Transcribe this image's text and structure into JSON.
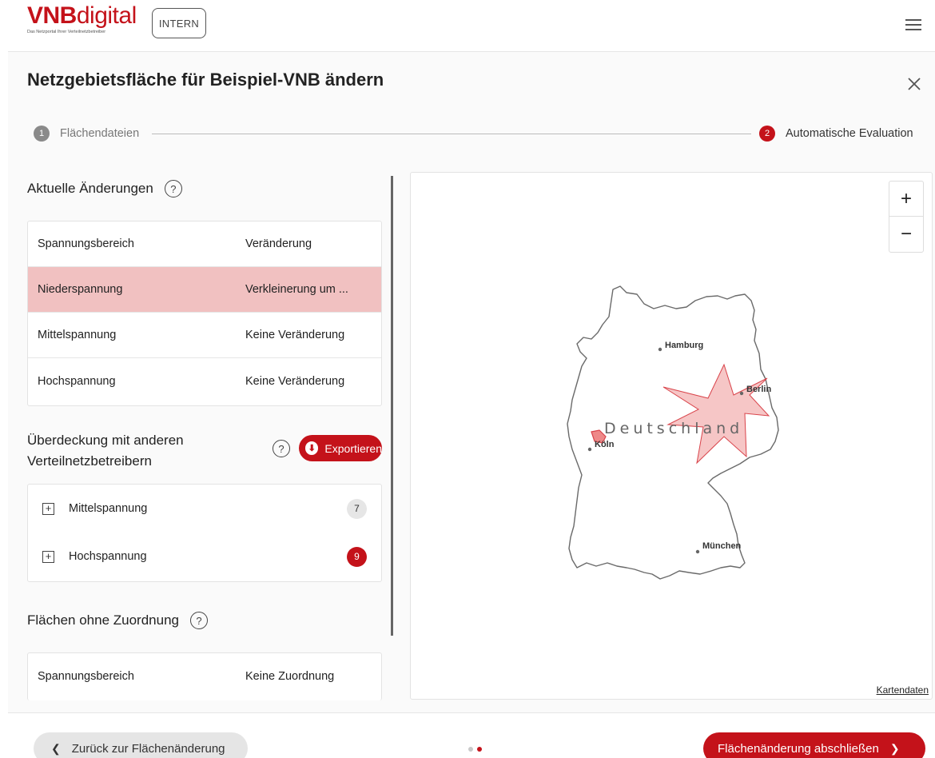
{
  "header": {
    "logo_bold": "VNB",
    "logo_light": "digital",
    "logo_tagline": "Das Netzportal Ihrer Verteilnetzbetreiber",
    "badge": "INTERN",
    "menu_icon": "hamburger-icon"
  },
  "dialog": {
    "title": "Netzgebietsfläche für Beispiel-VNB ändern",
    "close_icon": "close-icon",
    "steps": [
      {
        "num": "1",
        "label": "Flächendateien"
      },
      {
        "num": "2",
        "label": "Automatische Evaluation"
      }
    ]
  },
  "changes": {
    "title": "Aktuelle Änderungen",
    "help": "?",
    "header": {
      "c1": "Spannungsbereich",
      "c2": "Veränderung"
    },
    "rows": [
      {
        "c1": "Niederspannung",
        "c2": "Verkleinerung um ..."
      },
      {
        "c1": "Mittelspannung",
        "c2": "Keine Veränderung"
      },
      {
        "c1": "Hochspannung",
        "c2": "Keine Veränderung"
      }
    ]
  },
  "overlap": {
    "title_line1": "Überdeckung mit anderen",
    "title_line2": "Verteilnetzbetreibern",
    "help": "?",
    "export_label": "Exportieren",
    "items": [
      {
        "label": "Mittelspannung",
        "count": "7"
      },
      {
        "label": "Hochspannung",
        "count": "9"
      }
    ]
  },
  "unassigned": {
    "title": "Flächen ohne Zuordnung",
    "help": "?",
    "header": {
      "c1": "Spannungsbereich",
      "c2": "Keine Zuordnung"
    }
  },
  "map": {
    "zoom_in": "+",
    "zoom_out": "−",
    "country_label": "Deutschland",
    "cities": [
      "Hamburg",
      "Berlin",
      "Köln",
      "München"
    ],
    "attribution": "Kartendaten",
    "highlight_color": "#f4bcbc",
    "highlight_stroke": "#d9434a"
  },
  "footer": {
    "back_label": "Zurück zur Flächenänderung",
    "finish_label": "Flächenänderung abschließen",
    "page_dots": 2,
    "active_dot": 2
  },
  "colors": {
    "brand": "#c4121a",
    "highlight_row": "#f1c1c1"
  }
}
